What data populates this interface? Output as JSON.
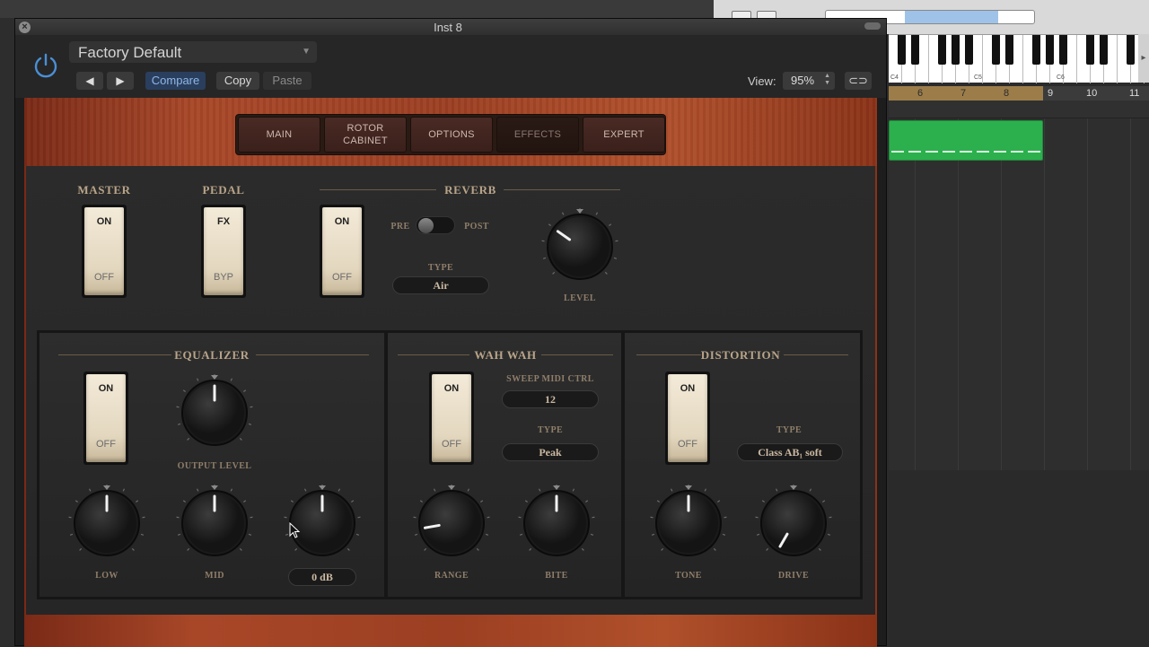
{
  "window": {
    "title": "Inst 8"
  },
  "header": {
    "preset": "Factory Default",
    "compare": "Compare",
    "copy": "Copy",
    "paste": "Paste",
    "view_label": "View:",
    "view_value": "95%"
  },
  "tabs": [
    {
      "label": "MAIN",
      "active": false
    },
    {
      "label": "ROTOR\nCABINET",
      "active": false
    },
    {
      "label": "OPTIONS",
      "active": false
    },
    {
      "label": "EFFECTS",
      "active": true
    },
    {
      "label": "EXPERT",
      "active": false
    }
  ],
  "top_section": {
    "master": {
      "label": "MASTER",
      "on": "ON",
      "off": "OFF"
    },
    "pedal": {
      "label": "PEDAL",
      "on": "FX",
      "off": "BYP"
    },
    "reverb": {
      "label": "REVERB",
      "on": "ON",
      "off": "OFF",
      "pre": "PRE",
      "post": "POST",
      "type_label": "TYPE",
      "type_value": "Air",
      "level_label": "LEVEL"
    }
  },
  "equalizer": {
    "label": "EQUALIZER",
    "on": "ON",
    "off": "OFF",
    "output_level": "OUTPUT LEVEL",
    "low": "LOW",
    "mid": "MID",
    "gain_value": "0 dB"
  },
  "wahwah": {
    "label": "WAH WAH",
    "on": "ON",
    "off": "OFF",
    "sweep_label": "SWEEP MIDI CTRL",
    "sweep_value": "12",
    "type_label": "TYPE",
    "type_value": "Peak",
    "range": "RANGE",
    "bite": "BITE"
  },
  "distortion": {
    "label": "DISTORTION",
    "on": "ON",
    "off": "OFF",
    "type_label": "TYPE",
    "type_value": "Class AB₁ soft",
    "tone": "TONE",
    "drive": "DRIVE"
  },
  "daw": {
    "ruler": [
      "6",
      "7",
      "8",
      "9",
      "10",
      "11"
    ],
    "keys": [
      "C4",
      "C5",
      "C6"
    ]
  },
  "colors": {
    "wood": "#a84728",
    "panel": "#2b2b2b",
    "region": "#2bb04d",
    "label": "#b9a489"
  },
  "icons": [
    "close-icon",
    "power-icon",
    "prev-icon",
    "next-icon",
    "link-icon",
    "cursor-icon"
  ]
}
